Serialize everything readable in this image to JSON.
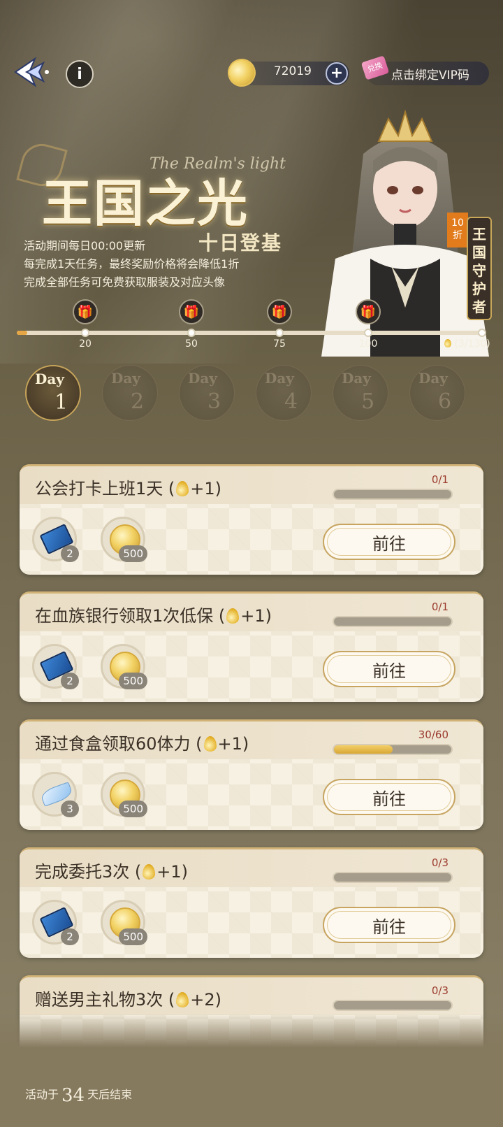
{
  "header": {
    "coin_amount": "72019",
    "plus_label": "+",
    "info_label": "i",
    "ticket_label": "兑换",
    "vip_label": "点击绑定VIP码"
  },
  "event": {
    "title": "王国之光",
    "title_en": "The Realm's light",
    "subtitle": "十日登基",
    "desc": [
      "活动期间每日00:00更新",
      "每完成1天任务，最终奖励价格将会降低1折",
      "完成全部任务可免费获取服装及对应头像"
    ],
    "badge_discount": "10折",
    "badge_title": "王国守护者"
  },
  "progress": {
    "current": 3,
    "max": 130,
    "milestones": [
      "20",
      "50",
      "75",
      "100"
    ],
    "count_text": "(3/130)"
  },
  "days": [
    {
      "word": "Day",
      "num": "1"
    },
    {
      "word": "Day",
      "num": "2"
    },
    {
      "word": "Day",
      "num": "3"
    },
    {
      "word": "Day",
      "num": "4"
    },
    {
      "word": "Day",
      "num": "5"
    },
    {
      "word": "Day",
      "num": "6"
    }
  ],
  "tasks": [
    {
      "title_pre": "公会打卡上班1天 (",
      "title_post": "+1)",
      "count": "0/1",
      "progress": 0,
      "button": "前往",
      "rewards": [
        {
          "icon": "chip-icon",
          "qty": "2"
        },
        {
          "icon": "coin-icon",
          "qty": "500"
        }
      ]
    },
    {
      "title_pre": "在血族银行领取1次低保 (",
      "title_post": "+1)",
      "count": "0/1",
      "progress": 0,
      "button": "前往",
      "rewards": [
        {
          "icon": "chip-icon",
          "qty": "2"
        },
        {
          "icon": "coin-icon",
          "qty": "500"
        }
      ]
    },
    {
      "title_pre": "通过食盒领取60体力 (",
      "title_post": "+1)",
      "count": "30/60",
      "progress": 0.5,
      "button": "前往",
      "rewards": [
        {
          "icon": "feather-icon",
          "qty": "3"
        },
        {
          "icon": "coin-icon",
          "qty": "500"
        }
      ]
    },
    {
      "title_pre": "完成委托3次 (",
      "title_post": "+1)",
      "count": "0/3",
      "progress": 0,
      "button": "前往",
      "rewards": [
        {
          "icon": "chip-icon",
          "qty": "2"
        },
        {
          "icon": "coin-icon",
          "qty": "500"
        }
      ]
    },
    {
      "title_pre": "赠送男主礼物3次 (",
      "title_post": "+2)",
      "count": "0/3",
      "progress": 0,
      "button": "前往",
      "rewards": []
    }
  ],
  "footer": {
    "pre": "活动于",
    "days": "34",
    "post": "天后结束"
  }
}
